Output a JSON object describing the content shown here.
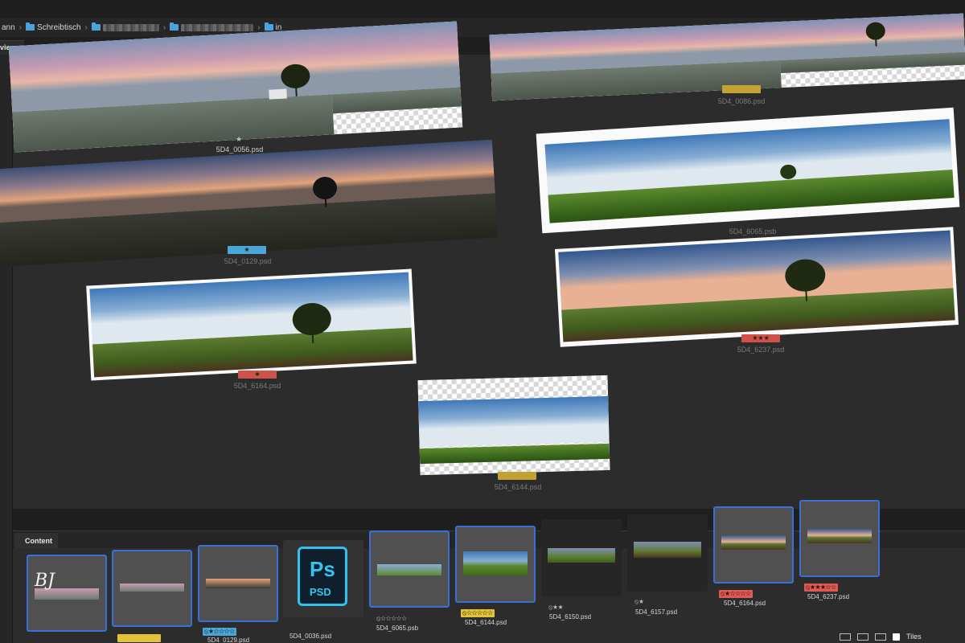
{
  "breadcrumb": {
    "items": [
      {
        "label": "ann",
        "folder": false
      },
      {
        "label": "Schreibtisch",
        "folder": true
      },
      {
        "label": "",
        "folder": true,
        "blurred": true
      },
      {
        "label": "in",
        "folder": true
      }
    ]
  },
  "preview_tab": {
    "label": "view"
  },
  "preview_panos": [
    {
      "file": "5D4_0056.psd",
      "rating_mark": "★",
      "badge": "",
      "badge_color": "",
      "scene": "dawn"
    },
    {
      "file": "5D4_0086.psd",
      "rating_mark": "",
      "badge": "",
      "badge_color": "#c2a233",
      "scene": "dawn"
    },
    {
      "file": "5D4_0129.psd",
      "rating_mark": "",
      "badge": "★",
      "badge_color": "#4aa6d6",
      "scene": "dusk"
    },
    {
      "file": "5D4_6065.psb",
      "rating_mark": "",
      "badge": "",
      "badge_color": "",
      "scene": "day"
    },
    {
      "file": "5D4_6164.psd",
      "rating_mark": "",
      "badge": "★",
      "badge_color": "#d0504a",
      "scene": "day"
    },
    {
      "file": "5D4_6237.psd",
      "rating_mark": "",
      "badge": "★★★",
      "badge_color": "#d0504a",
      "scene": "eve"
    },
    {
      "file": "5D4_6144.psd",
      "rating_mark": "",
      "badge": "",
      "badge_color": "#c2a233",
      "scene": "day"
    }
  ],
  "content_panel": {
    "tab_label": "Content",
    "thumbnails": [
      {
        "file": "",
        "rating": "",
        "selected": true
      },
      {
        "file": "",
        "rating": "",
        "badge_color": "#e3c23a",
        "selected": true
      },
      {
        "file": "5D4_0129.psd",
        "rating": "⦸★☆☆☆☆",
        "badge_color": "#4aa6d6",
        "selected": true
      },
      {
        "file": "5D4_0036.psd",
        "rating": "",
        "selected": false,
        "icon": "PSD"
      },
      {
        "file": "5D4_6065.psb",
        "rating": "⦸☆☆☆☆☆",
        "selected": true
      },
      {
        "file": "5D4_6144.psd",
        "rating": "⦸☆☆☆☆☆",
        "badge_color": "#e3c23a",
        "selected": true
      },
      {
        "file": "5D4_6150.psd",
        "rating": "⦸★★",
        "selected": false
      },
      {
        "file": "5D4_6157.psd",
        "rating": "⦸★",
        "selected": false
      },
      {
        "file": "5D4_6164.psd",
        "rating": "⦸★☆☆☆☆",
        "badge_color": "#e05a55",
        "selected": true
      },
      {
        "file": "5D4_6237.psd",
        "rating": "⦸★★★☆☆",
        "badge_color": "#e05a55",
        "selected": true
      }
    ],
    "ps_icon": {
      "line1": "Ps",
      "line2": "PSD"
    },
    "signature": "BJ"
  },
  "view_controls": {
    "tiles_label": "Tiles",
    "tiles_checked": true
  }
}
